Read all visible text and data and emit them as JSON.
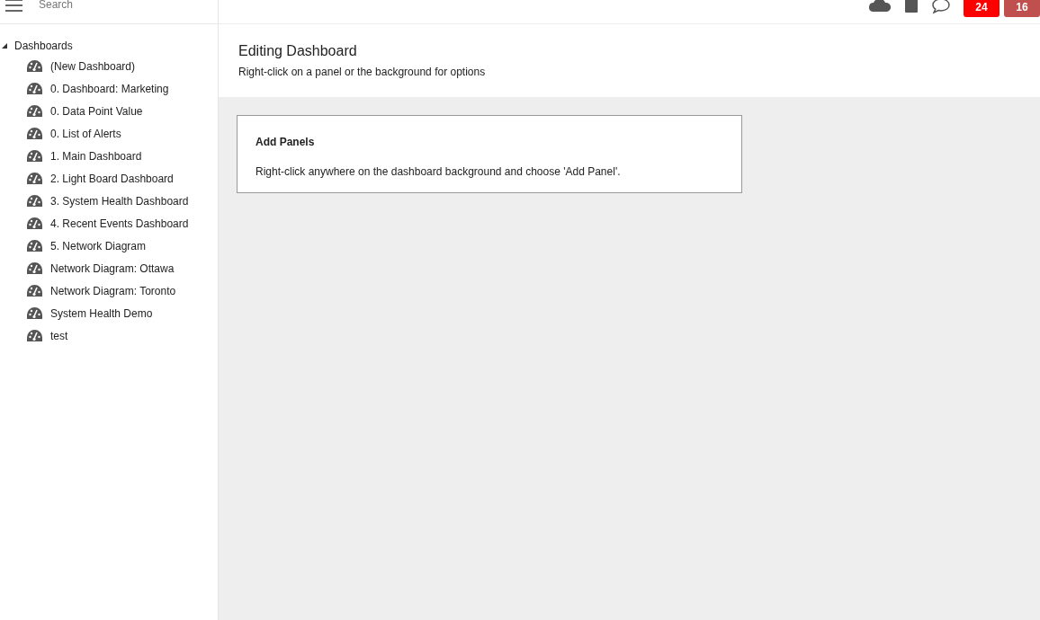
{
  "search": {
    "placeholder": "Search"
  },
  "badges": [
    {
      "count": "24",
      "color": "#ff0000"
    },
    {
      "count": "16",
      "color": "#c0504d"
    }
  ],
  "tree": [
    {
      "label": "Dashboards",
      "expanded": true,
      "children": [
        {
          "label": "(New Dashboard)"
        },
        {
          "label": "0. Dashboard: Marketing"
        },
        {
          "label": "0. Data Point Value"
        },
        {
          "label": "0. List of Alerts"
        },
        {
          "label": "1. Main Dashboard"
        },
        {
          "label": "2. Light Board Dashboard"
        },
        {
          "label": "3. System Health Dashboard"
        },
        {
          "label": "4. Recent Events Dashboard"
        },
        {
          "label": "5. Network Diagram"
        },
        {
          "label": "Network Diagram: Ottawa"
        },
        {
          "label": "Network Diagram: Toronto"
        },
        {
          "label": "System Health Demo"
        },
        {
          "label": "test"
        }
      ]
    }
  ],
  "page": {
    "title": "Editing Dashboard",
    "subtitle": "Right-click on a panel or the background for options"
  },
  "panel": {
    "title": "Add Panels",
    "text": "Right-click anywhere on the dashboard background and choose 'Add Panel'."
  }
}
